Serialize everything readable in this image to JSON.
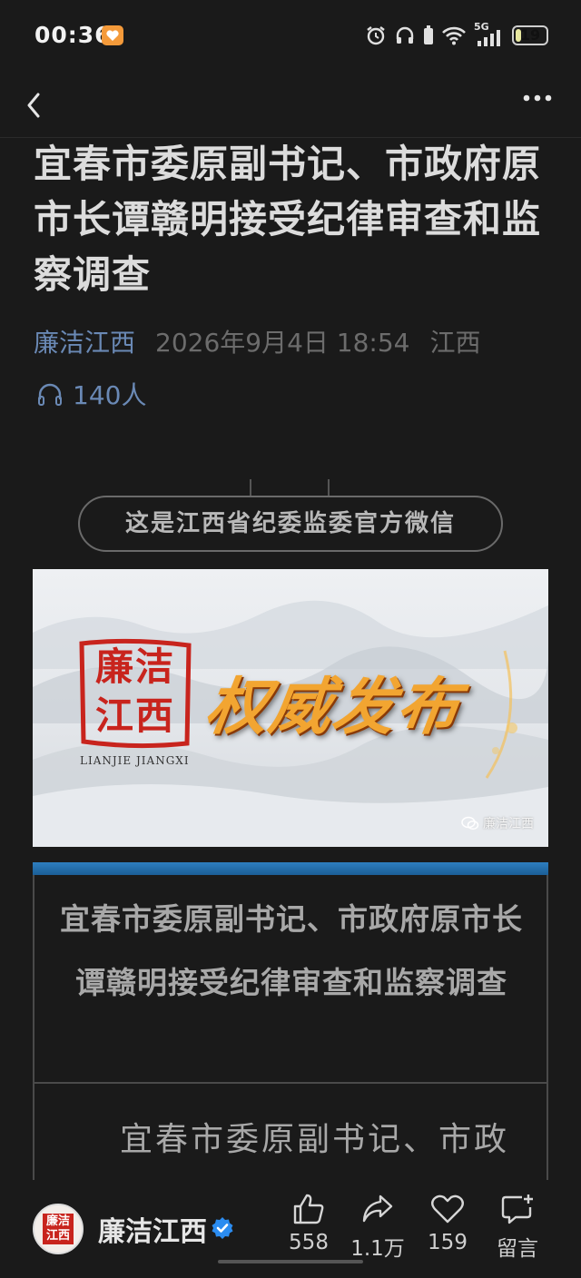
{
  "status_bar": {
    "time": "00:36",
    "network": "5G",
    "battery": "19",
    "battery_level": 0.19
  },
  "nav": {
    "back_icon": "chevron-left-icon",
    "more_icon": "more-horizontal-icon"
  },
  "article": {
    "title": "宜春市委原副书记、市政府原市长谭赣明接受纪律审查和监察调查",
    "source": "廉洁江西",
    "date": "2026年9月4日 18:54",
    "region": "江西",
    "listeners": "140人"
  },
  "official_notice": "这是江西省纪委监委官方微信",
  "banner": {
    "seal_line1": "廉洁",
    "seal_line2": "江西",
    "seal_sub": "LIANJIE   JIANGXI",
    "headline": "权威发布",
    "watermark": "廉洁江西"
  },
  "content_box": {
    "heading": "宜春市委原副书记、市政府原市长谭赣明接受纪律审查和监察调查",
    "body_start": "宜春市委原副书记、市政"
  },
  "bottom_bar": {
    "avatar_text_1": "廉洁",
    "avatar_text_2": "江西",
    "author": "廉洁江西",
    "like_count": "558",
    "share_count": "1.1万",
    "favorite_count": "159",
    "comment_label": "留言"
  },
  "colors": {
    "background": "#1a1a1a",
    "link_blue": "#6a89b5",
    "seal_red": "#c8241d",
    "headline_gold": "#f2a531",
    "bar_blue": "#2e7ebf",
    "verified_blue": "#2b8cf0"
  }
}
